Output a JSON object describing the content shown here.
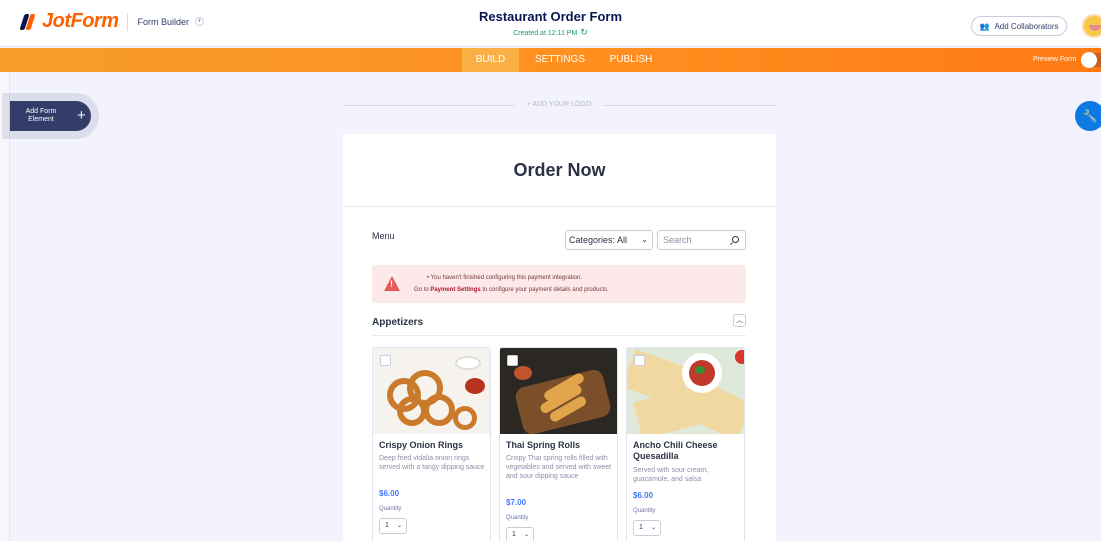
{
  "header": {
    "brand": "JotForm",
    "app_label": "Form Builder",
    "form_title": "Restaurant Order Form",
    "created_text": "Created at 12:11 PM",
    "collaborators_label": "Add Collaborators"
  },
  "nav": {
    "tabs": [
      {
        "label": "BUILD",
        "active": true
      },
      {
        "label": "SETTINGS",
        "active": false
      },
      {
        "label": "PUBLISH",
        "active": false
      }
    ],
    "preview_label": "Preview Form",
    "preview_enabled": false
  },
  "sidebar": {
    "add_element_label": "Add Form Element",
    "add_symbol": "+"
  },
  "canvas": {
    "add_logo_label": "+ ADD YOUR LOGO"
  },
  "form": {
    "heading": "Order Now",
    "menu_label": "Menu",
    "category_select": "Categories: All",
    "search_placeholder": "Search",
    "alert": {
      "line1": "• You haven't finished configuring this payment integration.",
      "line2_prefix": "Go to ",
      "line2_link": "Payment Settings",
      "line2_suffix": " to configure your payment details and products."
    },
    "section_title": "Appetizers",
    "quantity_label": "Quantity",
    "products": [
      {
        "name": "Crispy Onion Rings",
        "description": "Deep fried vidalia onion rings served with a tangy dipping sauce",
        "price": "$6.00",
        "quantity": "1"
      },
      {
        "name": "Thai Spring Rolls",
        "description": "Crispy Thai spring rolls filled with vegetables and served with sweet and sour dipping sauce",
        "price": "$7.00",
        "quantity": "1"
      },
      {
        "name": "Ancho Chili Cheese Quesadilla",
        "description": "Served with sour cream, guacamole, and salsa",
        "price": "$6.00",
        "quantity": "1"
      }
    ]
  },
  "colors": {
    "brand_orange": "#ff6100",
    "navy": "#0a1551",
    "price_blue": "#4277ff",
    "alert_bg": "#fde9e9"
  }
}
